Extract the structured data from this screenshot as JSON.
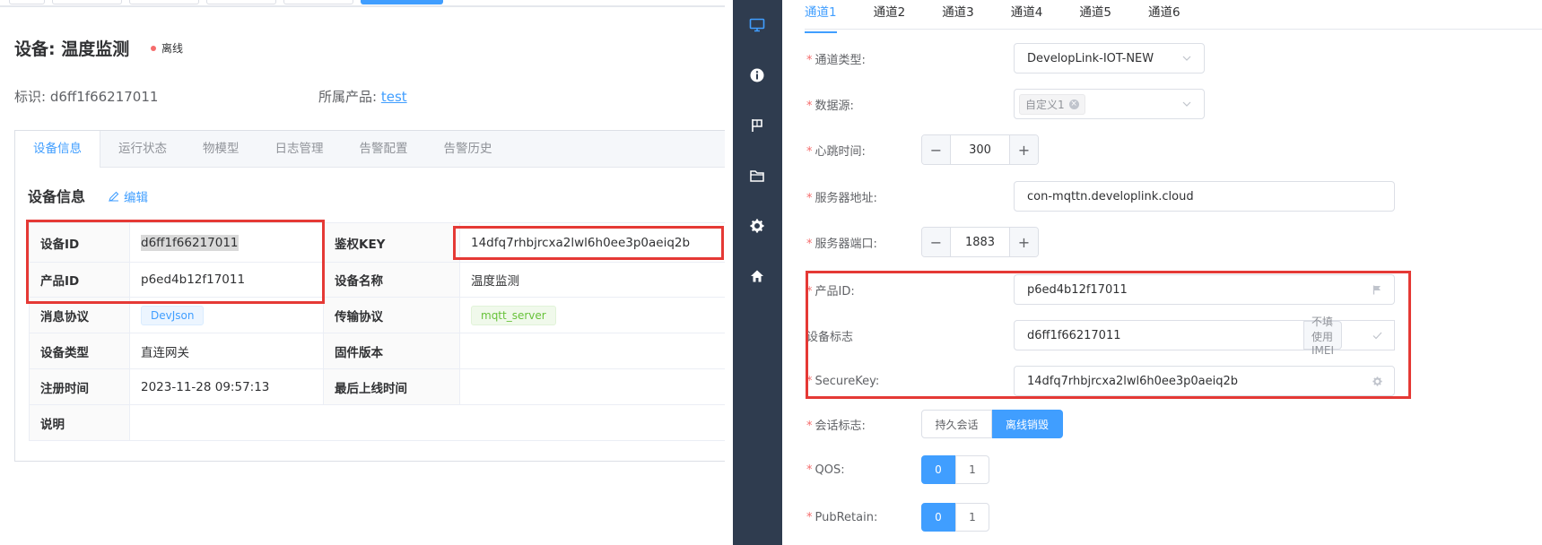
{
  "device_page": {
    "title": "设备: 温度监测",
    "status": "离线",
    "identifier_label": "标识:",
    "identifier_value": "d6ff1f66217011",
    "product_label": "所属产品:",
    "product_value": "test",
    "tabs": [
      "设备信息",
      "运行状态",
      "物模型",
      "日志管理",
      "告警配置",
      "告警历史"
    ],
    "section_title": "设备信息",
    "edit_label": "编辑",
    "info": {
      "device_id_label": "设备ID",
      "device_id_value": "d6ff1f66217011",
      "auth_key_label": "鉴权KEY",
      "auth_key_value": "14dfq7rhbjrcxa2lwl6h0ee3p0aeiq2b",
      "product_id_label": "产品ID",
      "product_id_value": "p6ed4b12f17011",
      "device_name_label": "设备名称",
      "device_name_value": "温度监测",
      "msg_protocol_label": "消息协议",
      "msg_protocol_value": "DevJson",
      "transport_label": "传输协议",
      "transport_value": "mqtt_server",
      "device_type_label": "设备类型",
      "device_type_value": "直连网关",
      "firmware_label": "固件版本",
      "firmware_value": "",
      "reg_time_label": "注册时间",
      "reg_time_value": "2023-11-28 09:57:13",
      "last_online_label": "最后上线时间",
      "last_online_value": "",
      "desc_label": "说明",
      "desc_value": ""
    }
  },
  "sidebar": {
    "icons": [
      "monitor-icon",
      "info-icon",
      "flag-icon",
      "folder-icon",
      "gear-icon",
      "home-icon"
    ]
  },
  "channel_form": {
    "tabs": [
      "通道1",
      "通道2",
      "通道3",
      "通道4",
      "通道5",
      "通道6"
    ],
    "channel_type_label": "通道类型:",
    "channel_type_value": "DevelopLink-IOT-NEW",
    "data_source_label": "数据源:",
    "data_source_chip": "自定义1",
    "heartbeat_label": "心跳时间:",
    "heartbeat_value": "300",
    "server_addr_label": "服务器地址:",
    "server_addr_value": "con-mqttn.developlink.cloud",
    "server_port_label": "服务器端口:",
    "server_port_value": "1883",
    "product_id_label": "产品ID:",
    "product_id_value": "p6ed4b12f17011",
    "device_flag_label": "设备标志",
    "device_flag_value": "d6ff1f66217011",
    "imei_button": "不填使用IMEI",
    "secure_key_label": "SecureKey:",
    "secure_key_value": "14dfq7rhbjrcxa2lwl6h0ee3p0aeiq2b",
    "session_label": "会话标志:",
    "session_options": [
      "持久会话",
      "离线销毁"
    ],
    "session_selected": "离线销毁",
    "qos_label": "QOS:",
    "qos_options": [
      "0",
      "1"
    ],
    "qos_selected": "0",
    "pubretain_label": "PubRetain:",
    "pubretain_options": [
      "0",
      "1"
    ],
    "pubretain_selected": "0"
  },
  "colors": {
    "accent": "#409eff",
    "highlight_box": "#e53935",
    "sidebar_bg": "#2f3c4f",
    "offline_dot": "#f56c6c"
  }
}
